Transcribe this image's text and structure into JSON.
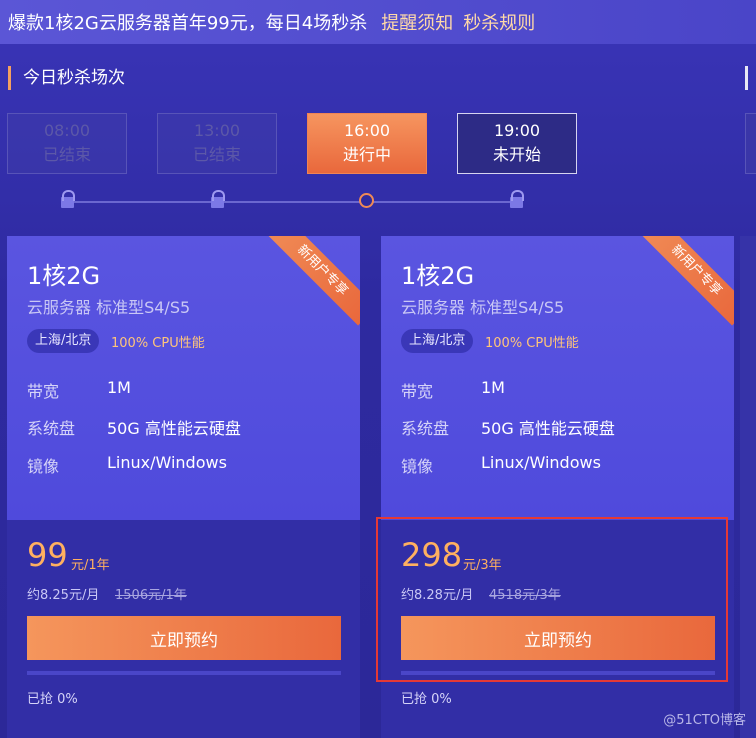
{
  "banner": {
    "text": "爆款1核2G云服务器首年99元，每日4场秒杀",
    "link_notice": "提醒须知",
    "link_rules": "秒杀规则"
  },
  "section_title": "今日秒杀场次",
  "sessions": [
    {
      "time": "08:00",
      "status": "已结束"
    },
    {
      "time": "13:00",
      "status": "已结束"
    },
    {
      "time": "16:00",
      "status": "进行中"
    },
    {
      "time": "19:00",
      "status": "未开始"
    }
  ],
  "cards": [
    {
      "ribbon": "新用户专享",
      "title": "1核2G",
      "subtitle": "云服务器 标准型S4/S5",
      "region": "上海/北京",
      "cpu": "100% CPU性能",
      "specs": [
        {
          "label": "带宽",
          "value": "1M"
        },
        {
          "label": "系统盘",
          "value": "50G 高性能云硬盘"
        },
        {
          "label": "镜像",
          "value": "Linux/Windows"
        }
      ],
      "price": "99",
      "price_unit": "元/1年",
      "price_note": "约8.25元/月",
      "price_original": "1506元/1年",
      "button": "立即预约",
      "progress_fraction": 0,
      "grabbed": "已抢 0%"
    },
    {
      "ribbon": "新用户专享",
      "title": "1核2G",
      "subtitle": "云服务器 标准型S4/S5",
      "region": "上海/北京",
      "cpu": "100% CPU性能",
      "specs": [
        {
          "label": "带宽",
          "value": "1M"
        },
        {
          "label": "系统盘",
          "value": "50G 高性能云硬盘"
        },
        {
          "label": "镜像",
          "value": "Linux/Windows"
        }
      ],
      "price": "298",
      "price_unit": "元/3年",
      "price_note": "约8.28元/月",
      "price_original": "4518元/3年",
      "button": "立即预约",
      "progress_fraction": 0,
      "grabbed": "已抢 0%"
    }
  ],
  "watermark": "@51CTO博客",
  "colors": {
    "accent_orange": "#e9683c",
    "price": "#ffb060",
    "highlight_border": "#e53935"
  }
}
